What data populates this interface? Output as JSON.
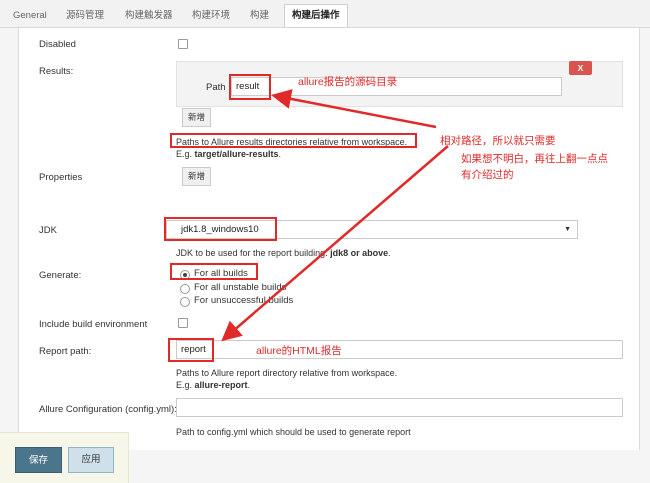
{
  "tabs": [
    {
      "label": "General",
      "active": false
    },
    {
      "label": "源码管理",
      "active": false
    },
    {
      "label": "构建触发器",
      "active": false
    },
    {
      "label": "构建环境",
      "active": false
    },
    {
      "label": "构建",
      "active": false
    },
    {
      "label": "构建后操作",
      "active": true
    }
  ],
  "form": {
    "disabled_label": "Disabled",
    "results_label": "Results:",
    "path_label": "Path",
    "path_value": "result",
    "close_label": "X",
    "add_label": "新增",
    "results_help_line1": "Paths to Allure results directories relative from workspace.",
    "results_help_prefix": "E.g. ",
    "results_help_example": "target/allure-results",
    "results_help_suffix": ".",
    "properties_label": "Properties",
    "properties_add_label": "新增",
    "jdk_label": "JDK",
    "jdk_value": "jdk1.8_windows10",
    "jdk_help_prefix": "JDK to be used for the report building. ",
    "jdk_help_bold": "jdk8 or above",
    "jdk_help_suffix": ".",
    "generate_label": "Generate:",
    "generate_options": [
      "For all builds",
      "For all unstable builds",
      "For unsuccessful builds"
    ],
    "generate_selected": "For all builds",
    "include_env_label": "Include build environment",
    "report_path_label": "Report path:",
    "report_path_value": "report",
    "report_help_line1": "Paths to Allure report directory relative from workspace.",
    "report_help_prefix": "E.g. ",
    "report_help_example": "allure-report",
    "report_help_suffix": ".",
    "config_label": "Allure Configuration (config.yml):",
    "config_value": "",
    "config_help": "Path to config.yml which should be used to generate report"
  },
  "footer": {
    "save_label": "保存",
    "apply_label": "应用"
  },
  "annotations": {
    "source_dir": "allure报告的源码目录",
    "relative_path": "相对路径，所以就只需要",
    "scroll_hint_line1": "如果想不明白，再往上翻一点点",
    "scroll_hint_line2": "有介绍过的",
    "html_report": "allure的HTML报告"
  },
  "colors": {
    "annotation_red": "#e02a2a",
    "save_button": "#4b758b",
    "apply_button": "#cfe0ea",
    "close_button": "#d9534f"
  }
}
